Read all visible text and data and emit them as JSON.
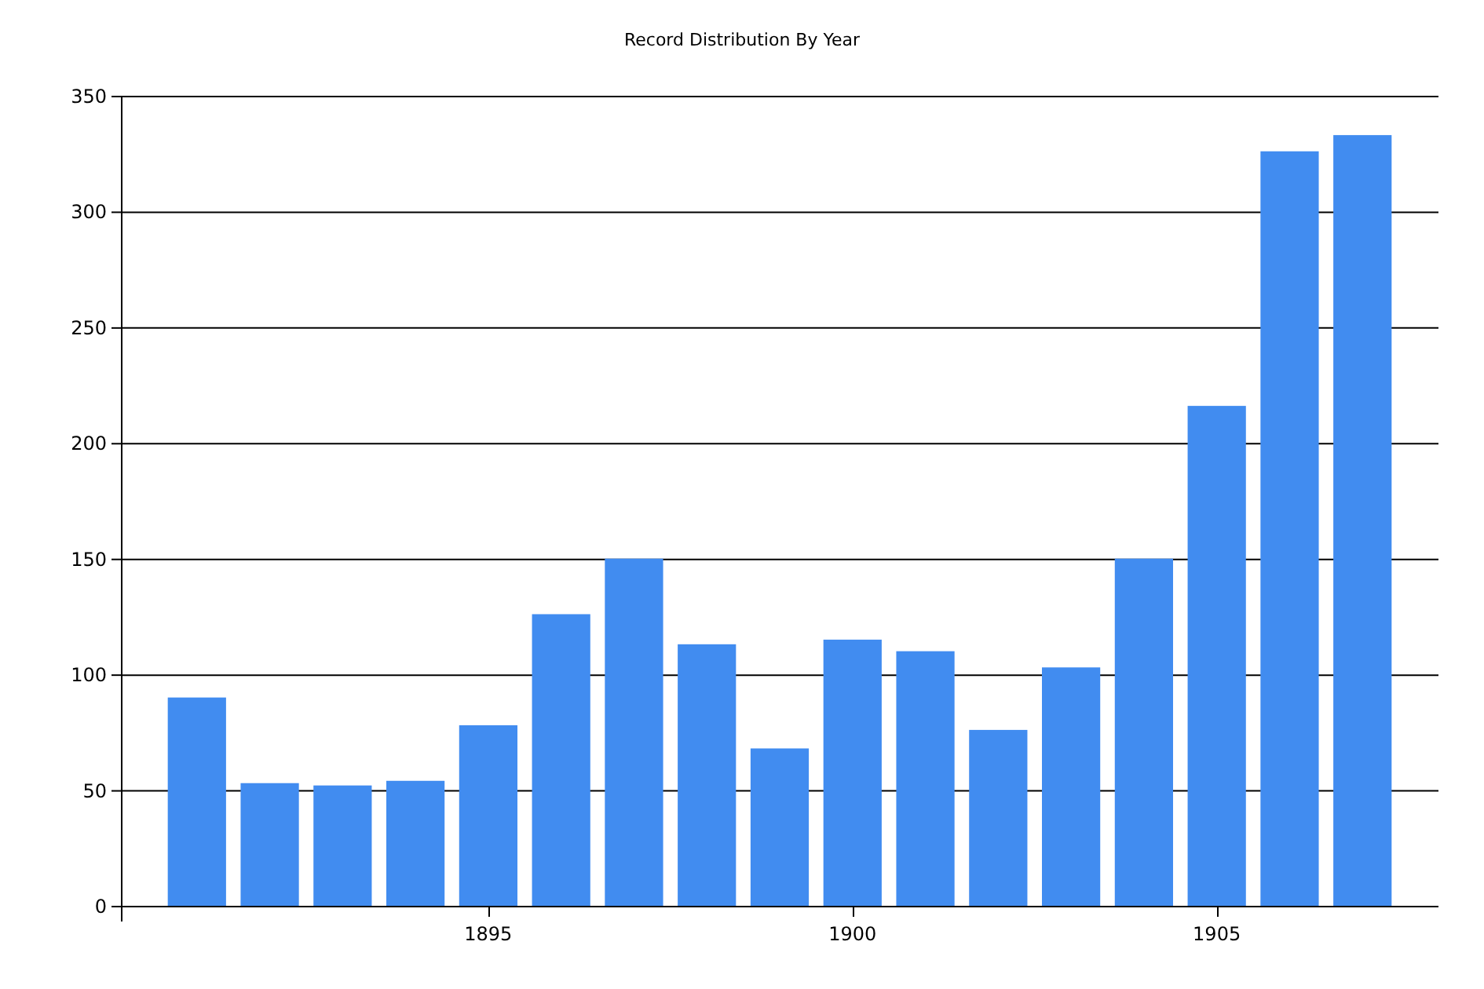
{
  "chart_data": {
    "type": "bar",
    "title": "Record Distribution By Year",
    "x": [
      1891,
      1892,
      1893,
      1894,
      1895,
      1896,
      1897,
      1898,
      1899,
      1900,
      1901,
      1902,
      1903,
      1904,
      1905,
      1906,
      1907
    ],
    "values": [
      90,
      53,
      52,
      54,
      78,
      126,
      150,
      113,
      68,
      115,
      110,
      76,
      103,
      150,
      216,
      326,
      333
    ],
    "xlim": [
      1890,
      1908
    ],
    "ylim": [
      0,
      350
    ],
    "xticks": [
      1895,
      1900,
      1905
    ],
    "yticks": [
      0,
      50,
      100,
      150,
      200,
      250,
      300,
      350
    ],
    "grid": true
  }
}
